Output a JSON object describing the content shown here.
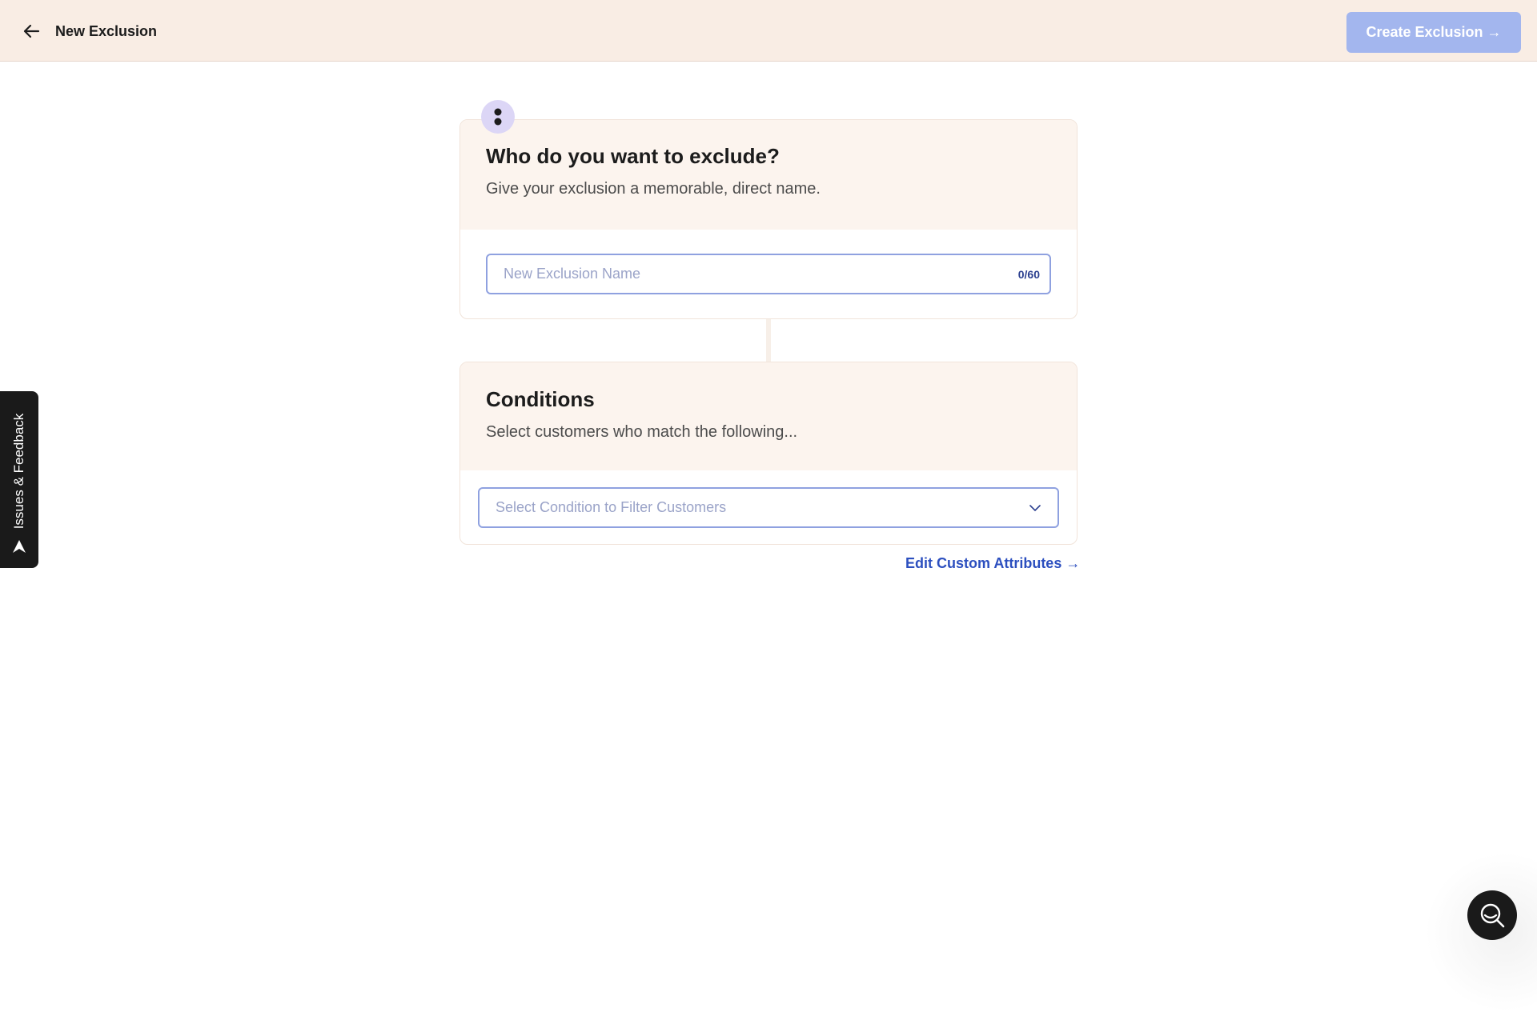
{
  "header": {
    "title": "New Exclusion",
    "back_icon": "arrow-left-icon",
    "create_button_label": "Create Exclusion →",
    "create_button_color": "#a3b6ee"
  },
  "name_card": {
    "step_icon": "drag-handle-icon",
    "title": "Who do you want to exclude?",
    "subtitle": "Give your exclusion a memorable, direct name.",
    "input_placeholder": "New Exclusion Name",
    "input_value": "",
    "char_count": "0/60"
  },
  "conditions_card": {
    "title": "Conditions",
    "subtitle": "Select customers who match the following...",
    "select_placeholder": "Select Condition to Filter Customers",
    "select_icon": "chevron-down-icon"
  },
  "edit_link": "Edit Custom Attributes →",
  "feedback_tab": {
    "label": "Issues & Feedback",
    "icon": "send-icon"
  },
  "chat_button": {
    "icon": "chat-search-icon"
  },
  "colors": {
    "header_bg": "#f9ede4",
    "card_head_bg": "#fcf4ee",
    "accent": "#2c4fbf",
    "input_border": "#8fa1e0"
  }
}
